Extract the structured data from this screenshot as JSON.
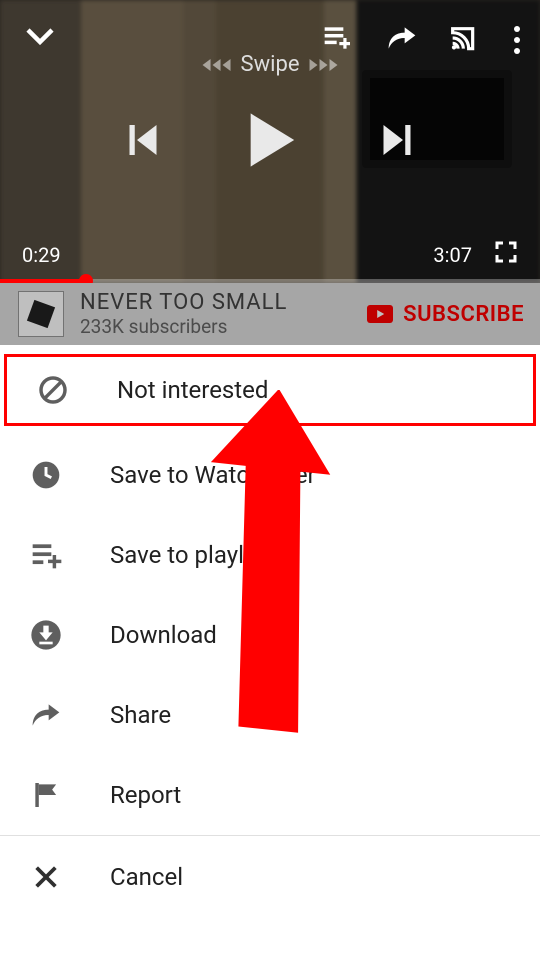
{
  "player": {
    "swipe_label": "Swipe",
    "current_time": "0:29",
    "duration": "3:07"
  },
  "channel": {
    "title": "NEVER TOO SMALL",
    "subscribers": "233K subscribers",
    "subscribe_label": "SUBSCRIBE"
  },
  "menu": {
    "not_interested": "Not interested",
    "watch_later": "Save to Watch later",
    "save_playlist": "Save to playlist",
    "download": "Download",
    "share": "Share",
    "report": "Report",
    "cancel": "Cancel"
  }
}
